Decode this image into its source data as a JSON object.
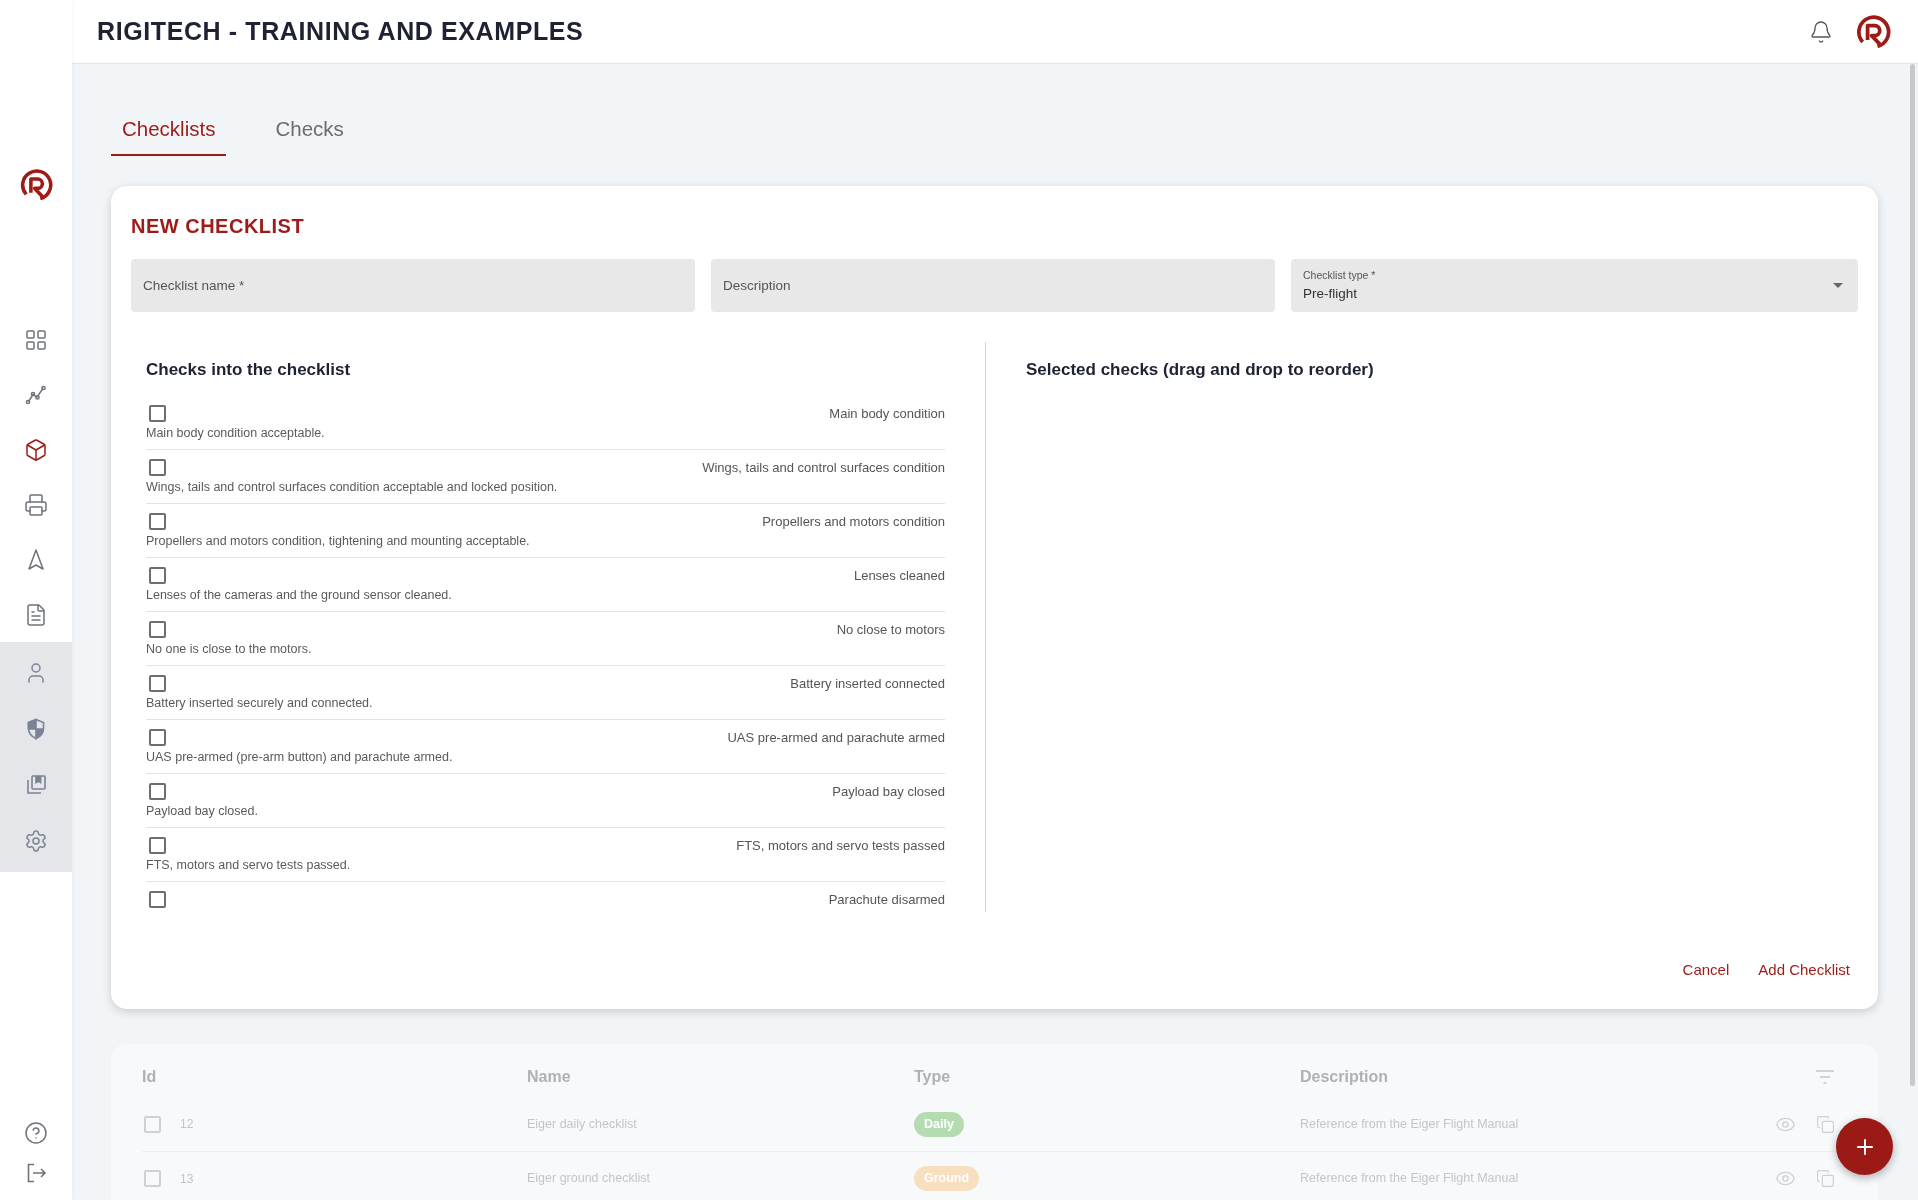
{
  "header": {
    "title": "RIGITECH - TRAINING AND EXAMPLES"
  },
  "sidebar": {
    "main_items": [
      {
        "selected": false
      },
      {
        "selected": false
      },
      {
        "selected": true
      },
      {
        "selected": false
      },
      {
        "selected": false
      },
      {
        "selected": false
      }
    ],
    "admin_items": [
      {
        "selected": false
      },
      {
        "selected": false
      },
      {
        "selected": false
      },
      {
        "selected": false
      }
    ]
  },
  "tabs": [
    {
      "label": "Checklists",
      "selected": true
    },
    {
      "label": "Checks",
      "selected": false
    }
  ],
  "form": {
    "title": "NEW CHECKLIST",
    "fields": [
      {
        "kind": "text",
        "placeholder": "Checklist name *"
      },
      {
        "kind": "text",
        "placeholder": "Description"
      },
      {
        "kind": "select",
        "label": "Checklist type *",
        "value": "Pre-flight"
      }
    ],
    "available": {
      "heading": "Checks into the checklist",
      "items": [
        {
          "title": "Main body condition",
          "description": "Main body condition acceptable.",
          "checked": false
        },
        {
          "title": "Wings, tails and control surfaces condition",
          "description": "Wings, tails and control surfaces condition acceptable and locked position.",
          "checked": false
        },
        {
          "title": "Propellers and motors condition",
          "description": "Propellers and motors condition, tightening and mounting acceptable.",
          "checked": false
        },
        {
          "title": "Lenses cleaned",
          "description": "Lenses of the cameras and the ground sensor cleaned.",
          "checked": false
        },
        {
          "title": "No close to motors",
          "description": "No one is close to the motors.",
          "checked": false
        },
        {
          "title": "Battery inserted connected",
          "description": "Battery inserted securely and connected.",
          "checked": false
        },
        {
          "title": "UAS pre-armed and parachute armed",
          "description": "UAS pre-armed (pre-arm button) and parachute armed.",
          "checked": false
        },
        {
          "title": "Payload bay closed",
          "description": "Payload bay closed.",
          "checked": false
        },
        {
          "title": "FTS, motors and servo tests passed",
          "description": "FTS, motors and servo tests passed.",
          "checked": false
        },
        {
          "title": "Parachute disarmed",
          "checked": false
        }
      ]
    },
    "selected": {
      "heading": "Selected checks (drag and drop to reorder)"
    },
    "buttons": [
      "Cancel",
      "Add Checklist"
    ]
  },
  "table": {
    "columns": [
      "Id",
      "Name",
      "Type",
      "Description"
    ],
    "rows": [
      {
        "checked": false,
        "id": "12",
        "name": "Eiger daily checklist",
        "type": {
          "label": "Daily",
          "color": "#b5dcb1"
        },
        "description": "Reference from the Eiger Flight Manual"
      },
      {
        "checked": false,
        "id": "13",
        "name": "Eiger ground checklist",
        "type": {
          "label": "Ground",
          "color": "#f8dfbf"
        },
        "description": "Reference from the Eiger Flight Manual"
      }
    ]
  }
}
